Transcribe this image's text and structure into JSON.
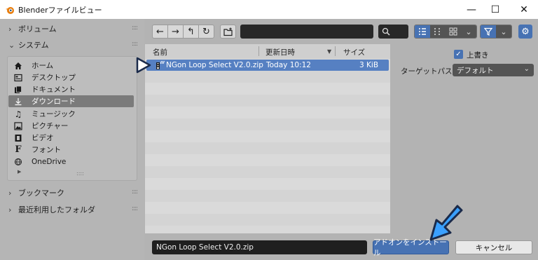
{
  "window": {
    "title": "Blenderファイルビュー",
    "minimize": "—",
    "maximize": "☐",
    "close": "✕"
  },
  "sidebar": {
    "volumes": "ボリューム",
    "system": "システム",
    "bookmarks": "ブックマーク",
    "recent": "最近利用したフォルダ",
    "items": [
      {
        "label": "ホーム",
        "icon": "home-icon"
      },
      {
        "label": "デスクトップ",
        "icon": "desktop-icon"
      },
      {
        "label": "ドキュメント",
        "icon": "documents-icon"
      },
      {
        "label": "ダウンロード",
        "icon": "download-icon"
      },
      {
        "label": "ミュージック",
        "icon": "music-icon"
      },
      {
        "label": "ピクチャー",
        "icon": "pictures-icon"
      },
      {
        "label": "ビデオ",
        "icon": "video-icon"
      },
      {
        "label": "フォント",
        "icon": "fonts-icon"
      },
      {
        "label": "OneDrive",
        "icon": "onedrive-icon"
      }
    ],
    "selected_index": 3
  },
  "toolbar": {
    "back": "←",
    "forward": "→",
    "parent": "↰",
    "refresh": "↻",
    "path_value": "",
    "search_value": ""
  },
  "filelist": {
    "col_name": "名前",
    "col_date": "更新日時",
    "col_size": "サイズ",
    "sort_indicator": "▼",
    "files": [
      {
        "name": "NGon Loop Select V2.0.zip",
        "date": "Today 10:12",
        "size": "3 KiB"
      }
    ]
  },
  "options": {
    "overwrite_label": "上書き",
    "overwrite_checked": true,
    "target_path_label": "ターゲットパス",
    "target_path_value": "デフォルト"
  },
  "bottom": {
    "filename": "NGon Loop Select V2.0.zip",
    "install_label": "アドオンをインストール",
    "cancel_label": "キャンセル"
  },
  "colors": {
    "accent": "#4772b3",
    "annotation": "#3aa0ff"
  }
}
